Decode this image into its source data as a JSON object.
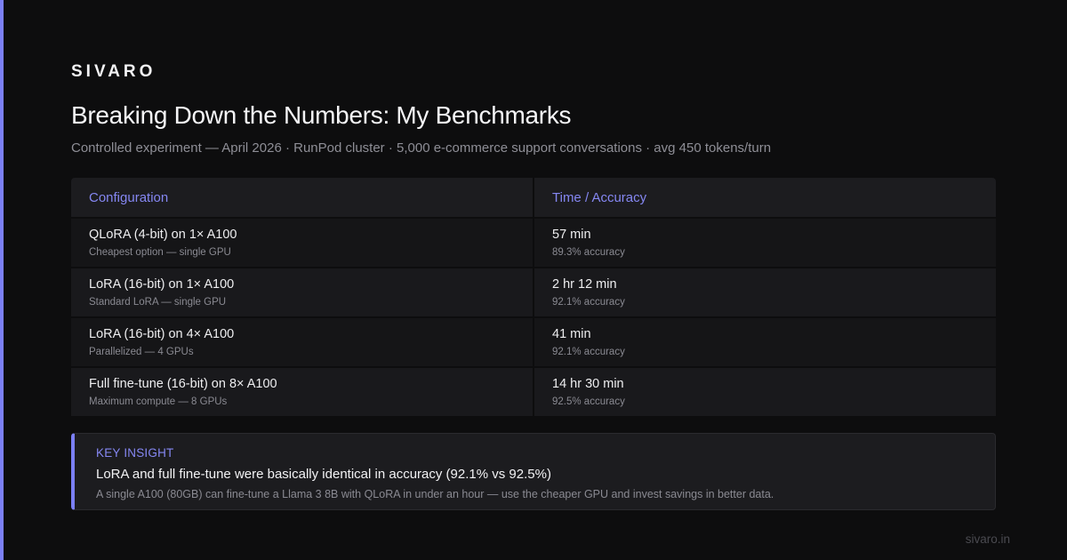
{
  "brand": "SIVARO",
  "title": "Breaking Down the Numbers: My Benchmarks",
  "subtitle": "Controlled experiment — April 2026 · RunPod cluster · 5,000 e-commerce support conversations · avg 450 tokens/turn",
  "table": {
    "headers": [
      "Configuration",
      "Time / Accuracy"
    ],
    "rows": [
      {
        "config": "QLoRA (4-bit) on 1× A100",
        "note": "Cheapest option — single GPU",
        "time": "57 min",
        "accuracy": "89.3% accuracy"
      },
      {
        "config": "LoRA (16-bit) on 1× A100",
        "note": "Standard LoRA — single GPU",
        "time": "2 hr 12 min",
        "accuracy": "92.1% accuracy"
      },
      {
        "config": "LoRA (16-bit) on 4× A100",
        "note": "Parallelized — 4 GPUs",
        "time": "41 min",
        "accuracy": "92.1% accuracy"
      },
      {
        "config": "Full fine-tune (16-bit) on 8× A100",
        "note": "Maximum compute — 8 GPUs",
        "time": "14 hr 30 min",
        "accuracy": "92.5% accuracy"
      }
    ]
  },
  "insight": {
    "label": "KEY INSIGHT",
    "headline": "LoRA and full fine-tune were basically identical in accuracy (92.1% vs 92.5%)",
    "detail": "A single A100 (80GB) can fine-tune a Llama 3 8B with QLoRA in under an hour — use the cheaper GPU and invest savings in better data."
  },
  "footer": "sivaro.in",
  "colors": {
    "accent": "#7b7ff5",
    "background": "#0d0d0e",
    "header_text": "#8587f2"
  }
}
